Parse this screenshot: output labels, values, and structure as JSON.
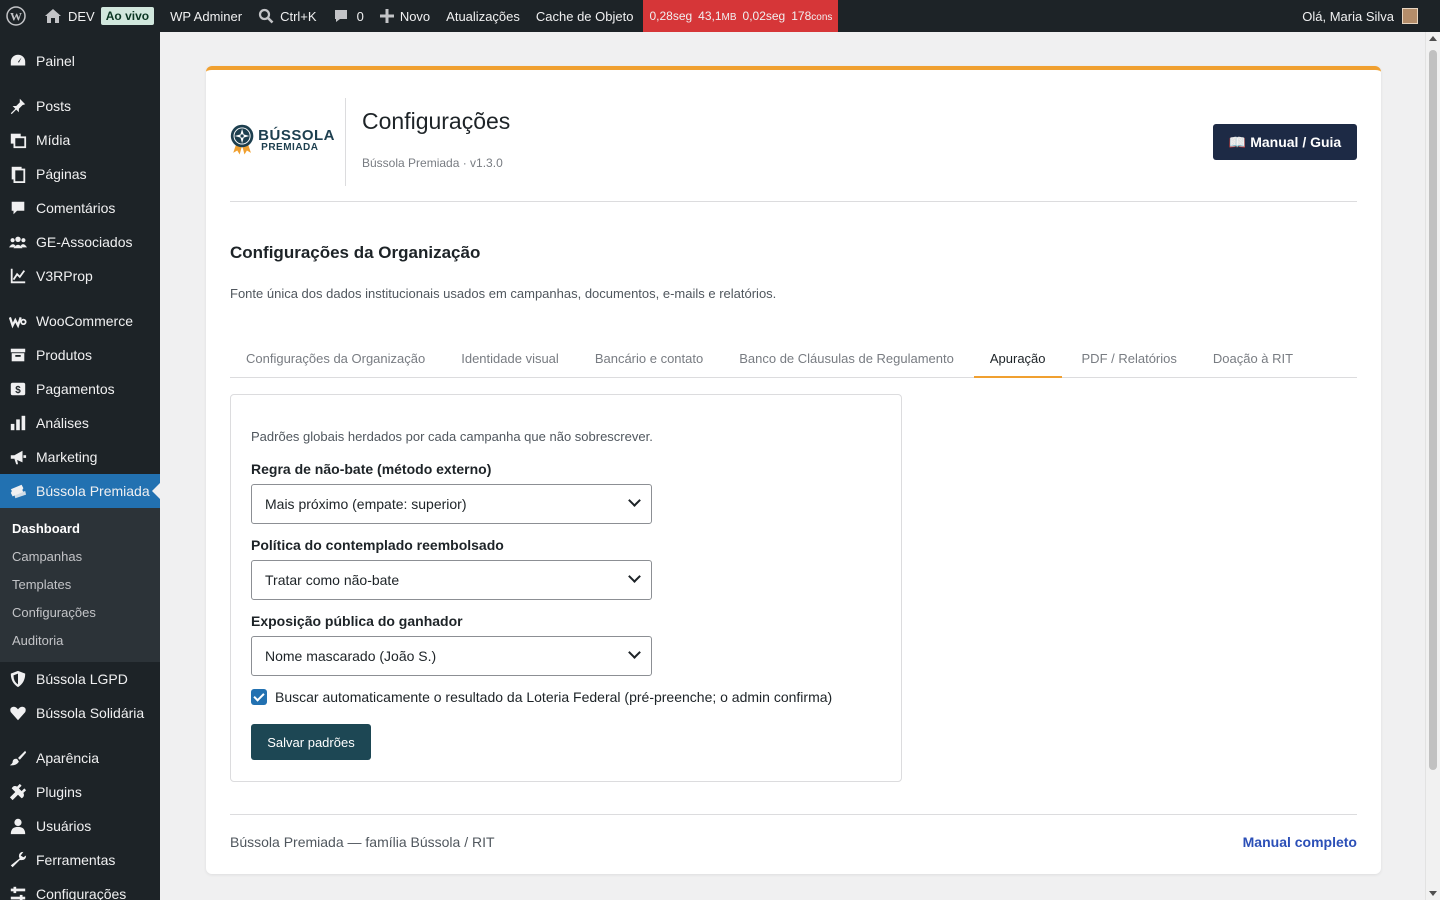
{
  "adminbar": {
    "site_name": "DEV",
    "live_badge": "Ao vivo",
    "adminer": "WP Adminer",
    "search": "Ctrl+K",
    "comments_count": "0",
    "new": "Novo",
    "updates": "Atualizações",
    "object_cache": "Cache de Objeto",
    "perf_time": "0,28seg",
    "perf_mem": "43,1",
    "perf_mem_unit": "MB",
    "perf_query_time": "0,02seg",
    "perf_queries": "178",
    "perf_queries_unit": "cons",
    "greeting": "Olá, Maria Silva"
  },
  "sidebar": {
    "items": [
      {
        "label": "Painel",
        "icon": "dashboard-icon"
      },
      {
        "label": "Posts",
        "icon": "pin-icon"
      },
      {
        "label": "Mídia",
        "icon": "media-icon"
      },
      {
        "label": "Páginas",
        "icon": "pages-icon"
      },
      {
        "label": "Comentários",
        "icon": "comment-icon"
      },
      {
        "label": "GE-Associados",
        "icon": "groups-icon"
      },
      {
        "label": "V3RProp",
        "icon": "chart-line-icon"
      },
      {
        "label": "WooCommerce",
        "icon": "woo-icon"
      },
      {
        "label": "Produtos",
        "icon": "archive-icon"
      },
      {
        "label": "Pagamentos",
        "icon": "money-icon"
      },
      {
        "label": "Análises",
        "icon": "bar-chart-icon"
      },
      {
        "label": "Marketing",
        "icon": "megaphone-icon"
      },
      {
        "label": "Bússola Premiada",
        "icon": "tickets-icon"
      },
      {
        "label": "Bússola LGPD",
        "icon": "shield-icon"
      },
      {
        "label": "Bússola Solidária",
        "icon": "heart-icon"
      },
      {
        "label": "Aparência",
        "icon": "brush-icon"
      },
      {
        "label": "Plugins",
        "icon": "plugin-icon"
      },
      {
        "label": "Usuários",
        "icon": "user-icon"
      },
      {
        "label": "Ferramentas",
        "icon": "wrench-icon"
      },
      {
        "label": "Configurações",
        "icon": "settings-icon"
      }
    ],
    "submenu": [
      "Dashboard",
      "Campanhas",
      "Templates",
      "Configurações",
      "Auditoria"
    ]
  },
  "header": {
    "logo_line1": "BÚSSOLA",
    "logo_line2": "PREMIADA",
    "title": "Configurações",
    "version": "Bússola Premiada · v1.3.0",
    "manual_button": "Manual / Guia",
    "manual_icon": "📖"
  },
  "section": {
    "title": "Configurações da Organização",
    "description": "Fonte única dos dados institucionais usados em campanhas, documentos, e-mails e relatórios."
  },
  "tabs": [
    "Configurações da Organização",
    "Identidade visual",
    "Bancário e contato",
    "Banco de Cláusulas de Regulamento",
    "Apuração",
    "PDF / Relatórios",
    "Doação à RIT"
  ],
  "panel": {
    "intro": "Padrões globais herdados por cada campanha que não sobrescrever.",
    "rule_label": "Regra de não-bate (método externo)",
    "rule_value": "Mais próximo (empate: superior)",
    "refund_label": "Política do contemplado reembolsado",
    "refund_value": "Tratar como não-bate",
    "exposure_label": "Exposição pública do ganhador",
    "exposure_value": "Nome mascarado (João S.)",
    "auto_fetch_label": "Buscar automaticamente o resultado da Loteria Federal (pré-preenche; o admin confirma)",
    "auto_fetch_checked": true,
    "save_button": "Salvar padrões"
  },
  "footer": {
    "left": "Bússola Premiada — família Bússola / RIT",
    "right": "Manual completo"
  },
  "colors": {
    "accent_orange": "#f0a030",
    "admin_dark": "#1d2327",
    "current_menu": "#2271b1",
    "save_button": "#1d4754",
    "manual_button": "#1d2a45",
    "perf_red": "#d63638"
  }
}
